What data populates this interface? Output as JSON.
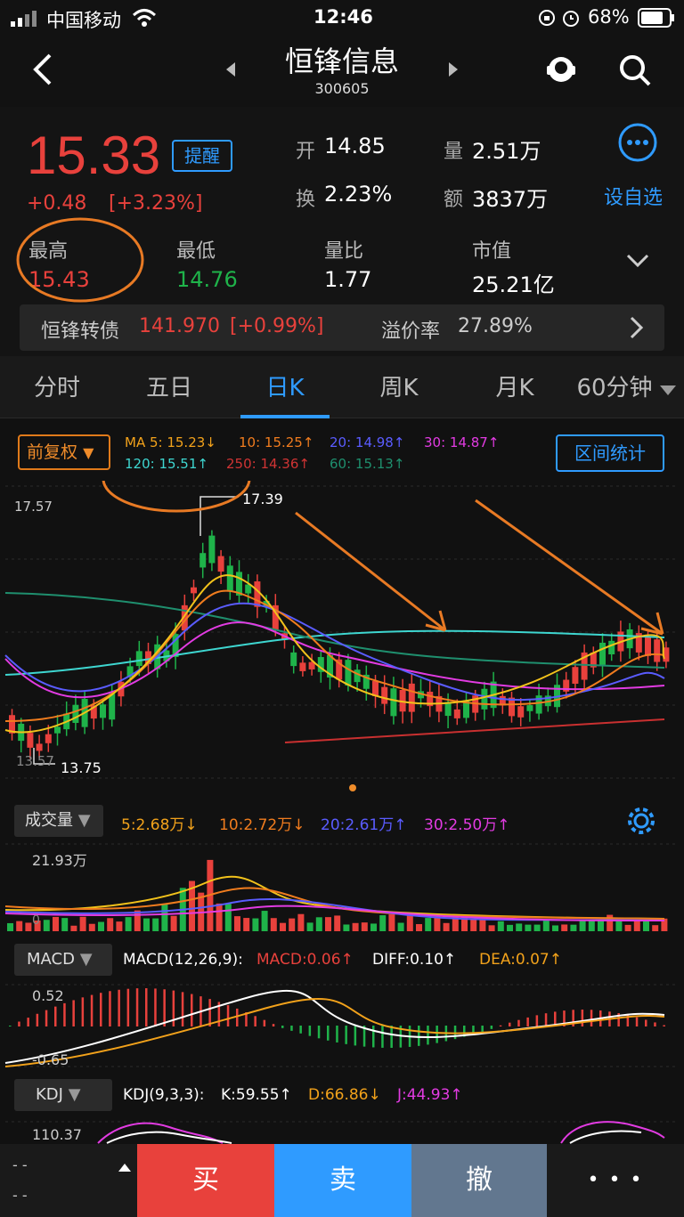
{
  "status": {
    "carrier": "中国移动",
    "time": "12:46",
    "battery": "68%"
  },
  "header": {
    "name": "恒锋信息",
    "code": "300605"
  },
  "quote": {
    "price": "15.33",
    "remind": "提醒",
    "change": "+0.48",
    "change_pct": "[+3.23%]",
    "open_label": "开",
    "open": "14.85",
    "vol_label": "量",
    "vol": "2.51万",
    "turn_label": "换",
    "turn": "2.23%",
    "amt_label": "额",
    "amt": "3837万",
    "watch": "设自选",
    "high_label": "最高",
    "high": "15.43",
    "low_label": "最低",
    "low": "14.76",
    "vr_label": "量比",
    "vr": "1.77",
    "mcap_label": "市值",
    "mcap": "25.21亿"
  },
  "bond": {
    "name": "恒锋转债",
    "price": "141.970",
    "pct": "[+0.99%]",
    "prem_label": "溢价率",
    "prem": "27.89%"
  },
  "tabs": [
    "分时",
    "五日",
    "日K",
    "周K",
    "月K",
    "60分钟"
  ],
  "kline": {
    "adjust": "前复权",
    "ma5": "MA 5: 15.23↓",
    "ma10": "10: 15.25↑",
    "ma20": "20: 14.98↑",
    "ma30": "30: 14.87↑",
    "ma120": "120: 15.51↑",
    "ma250": "250: 14.36↑",
    "ma60": "60: 15.13↑",
    "range_btn": "区间统计",
    "top_label": "17.57",
    "max_label": "17.39",
    "min_label": "13.75",
    "bottom_label": "13.57"
  },
  "volume": {
    "selector": "成交量",
    "ma5": "5:2.68万↓",
    "ma10": "10:2.72万↓",
    "ma20": "20:2.61万↑",
    "ma30": "30:2.50万↑",
    "max_label": "21.93万",
    "zero_label": "0"
  },
  "macd": {
    "selector": "MACD",
    "params": "MACD(12,26,9):",
    "macd": "MACD:0.06↑",
    "diff": "DIFF:0.10↑",
    "dea": "DEA:0.07↑",
    "top_label": "0.52",
    "bottom_label": "-0.65"
  },
  "kdj": {
    "selector": "KDJ",
    "params": "KDJ(9,3,3):",
    "k": "K:59.55↑",
    "d": "D:66.86↓",
    "j": "J:44.93↑",
    "top_label": "110.37"
  },
  "bottom": {
    "buy": "买",
    "sell": "卖",
    "cancel": "撤",
    "more": "• • •",
    "left_top": "- -",
    "left_bottom": "- -"
  },
  "colors": {
    "up": "#e8413c",
    "down": "#1fb34a",
    "accent": "#2f9bff",
    "annotation": "#e87a24"
  }
}
